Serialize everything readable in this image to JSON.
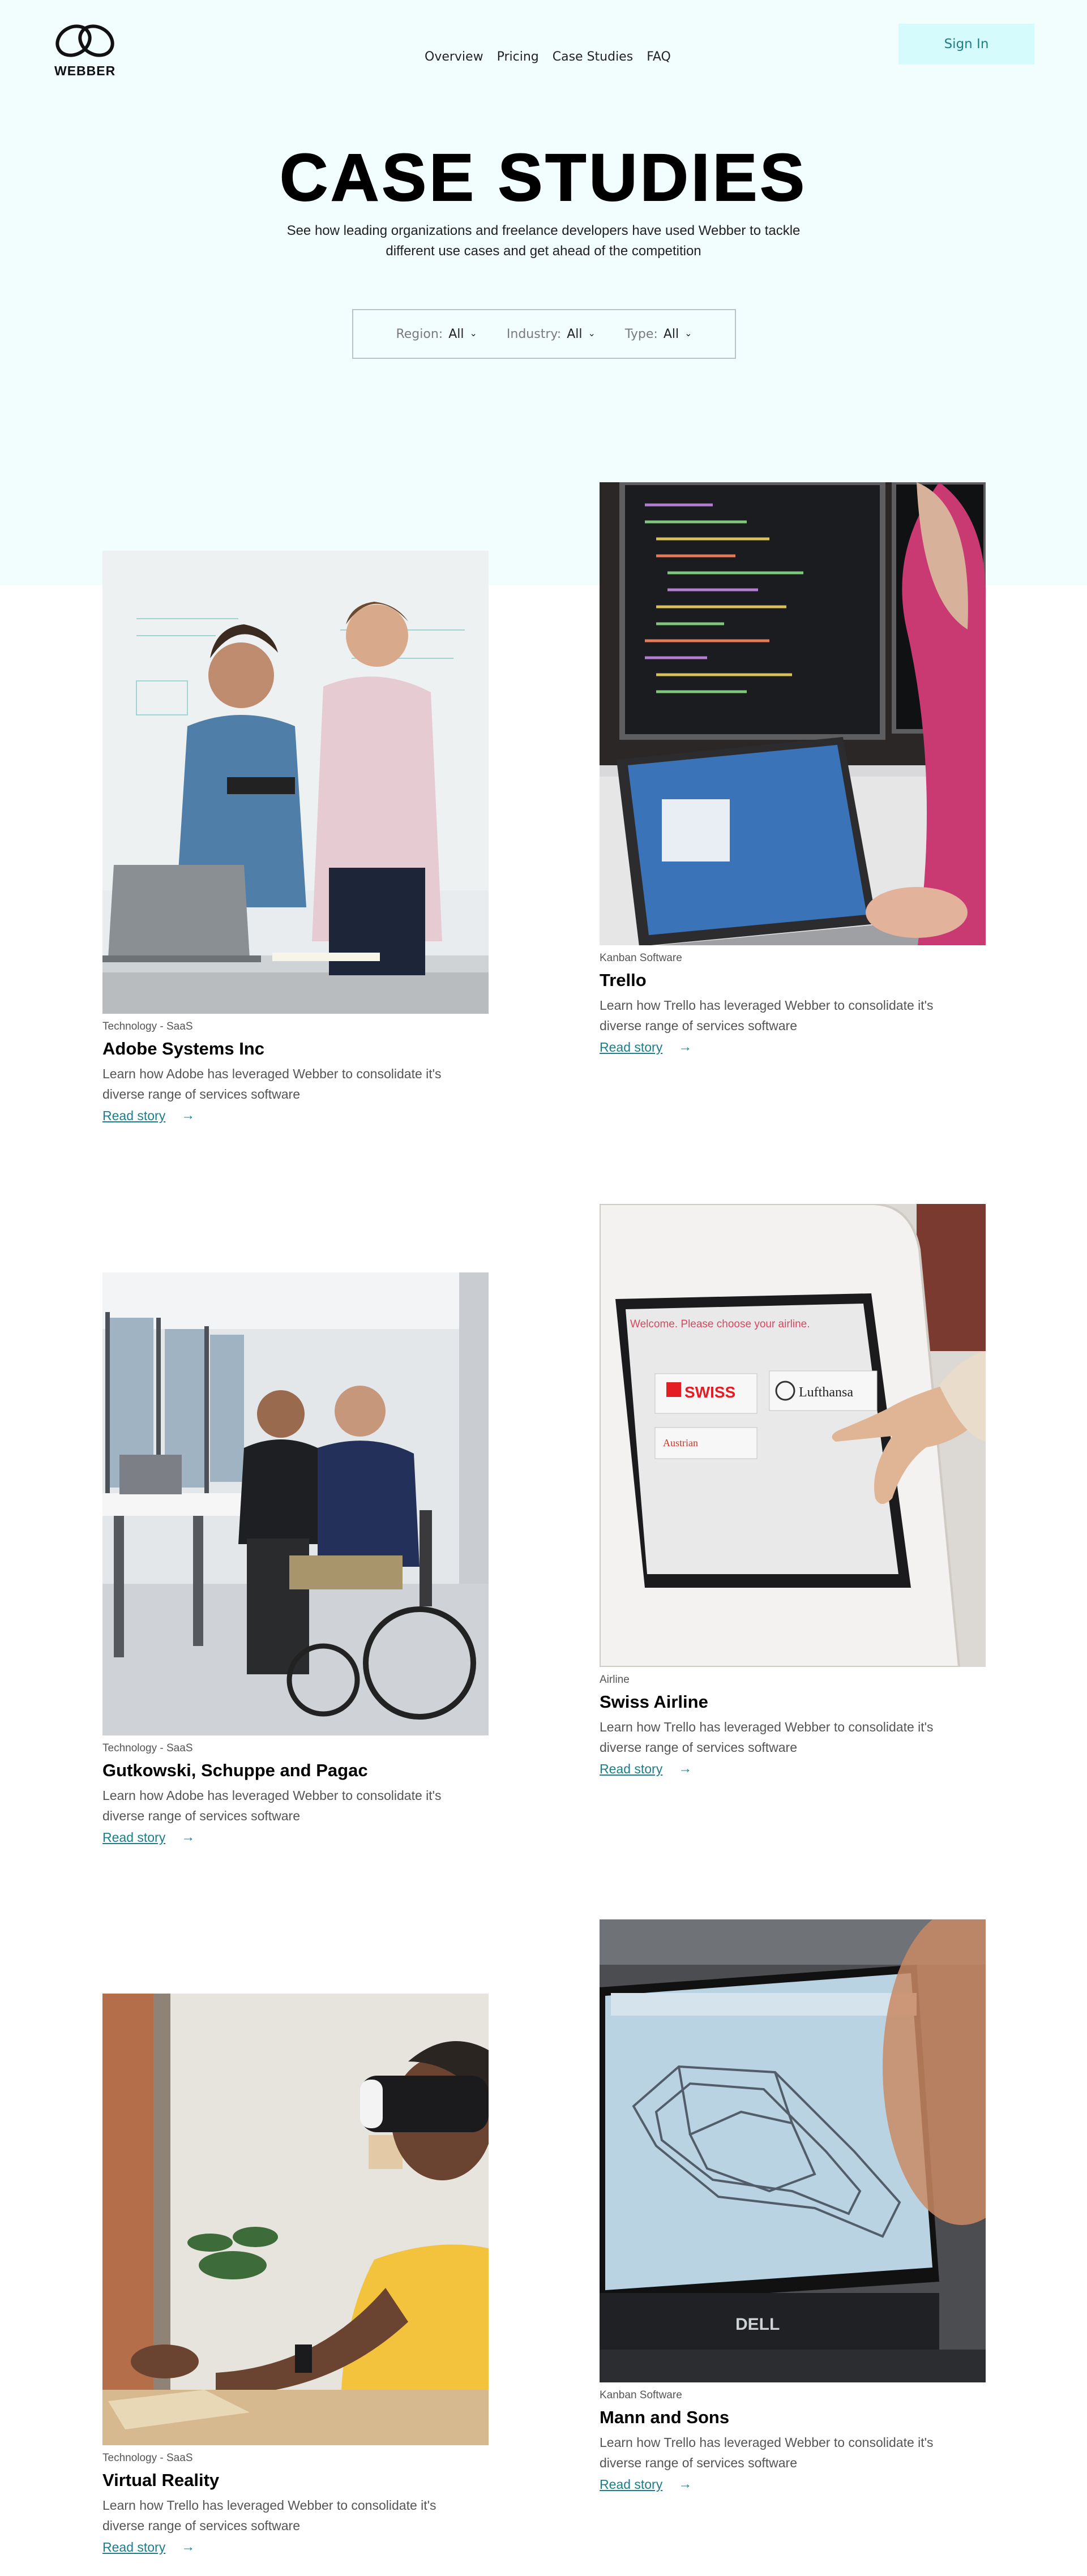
{
  "brand": {
    "name": "WEBBER"
  },
  "nav": {
    "items": [
      "Overview",
      "Pricing",
      "Case Studies",
      "FAQ"
    ]
  },
  "header": {
    "signin_label": "Sign In"
  },
  "hero": {
    "title": "CASE STUDIES",
    "subtitle": "See how leading organizations and freelance developers have used Webber to tackle different use cases and get ahead of the competition"
  },
  "filters": [
    {
      "label": "Region:",
      "value": "All"
    },
    {
      "label": "Industry:",
      "value": "All"
    },
    {
      "label": "Type:",
      "value": "All"
    }
  ],
  "cards": [
    {
      "category": "Technology - SaaS",
      "title": "Adobe Systems Inc",
      "description": "Learn how Adobe has leveraged Webber to consolidate it's diverse range of services software",
      "link": "Read story"
    },
    {
      "category": "Kanban Software",
      "title": "Trello",
      "description": "Learn how Trello has leveraged Webber to consolidate it's diverse range of services software",
      "link": "Read story"
    },
    {
      "category": "Technology - SaaS",
      "title": "Gutkowski, Schuppe and Pagac",
      "description": "Learn how Adobe has leveraged Webber to consolidate it's diverse range of services software",
      "link": "Read story"
    },
    {
      "category": "Airline",
      "title": "Swiss Airline",
      "description": "Learn how Trello has leveraged Webber to consolidate it's diverse range of services software",
      "link": "Read story"
    },
    {
      "category": "Technology - SaaS",
      "title": "Virtual Reality",
      "description": "Learn how Trello has leveraged Webber to consolidate it's diverse range of services software",
      "link": "Read story"
    },
    {
      "category": "Kanban Software",
      "title": "Mann and Sons",
      "description": "Learn how Trello has leveraged Webber to consolidate it's diverse range of services software",
      "link": "Read story"
    }
  ],
  "kiosk_screen": {
    "prompt": "Welcome. Please choose your airline.",
    "airlines": [
      "SWISS",
      "Lufthansa",
      "Austrian"
    ]
  },
  "laptop_brand": "DELL",
  "colors": {
    "hero_bg": "#f2fefe",
    "accent": "#1a7f8a",
    "signin_bg": "#d5fbfc"
  }
}
